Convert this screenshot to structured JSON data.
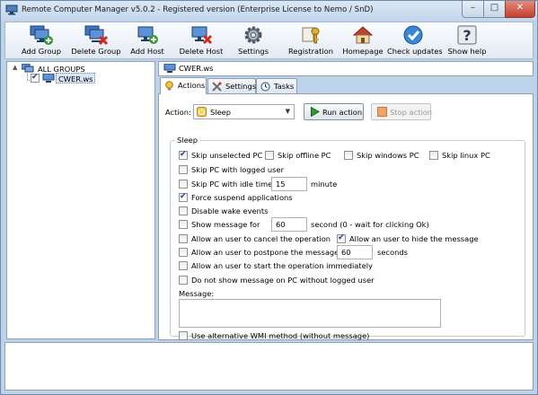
{
  "window": {
    "title": "Remote Computer Manager v5.0.2 - Registered version (Enterprise License to Nemo / SnD)",
    "minimize_glyph": "–",
    "maximize_glyph": "□",
    "close_glyph": "✕"
  },
  "toolbar": {
    "add_group": "Add Group",
    "delete_group": "Delete Group",
    "add_host": "Add Host",
    "delete_host": "Delete Host",
    "settings": "Settings",
    "registration": "Registration",
    "homepage": "Homepage",
    "check_updates": "Check updates",
    "show_help": "Show help"
  },
  "tree": {
    "expander": "▲",
    "root": "ALL GROUPS",
    "host": "CWER.ws"
  },
  "host_bar": {
    "name": "CWER.ws"
  },
  "tabs": {
    "actions": "Actions",
    "settings": "Settings",
    "tasks": "Tasks"
  },
  "actions": {
    "action_label": "Action:",
    "action_value": "Sleep",
    "combo_arrow": "▼",
    "run_button": "Run action",
    "stop_button": "Stop action",
    "group_title": "Sleep",
    "skip_unselected": "Skip unselected PC",
    "skip_offline": "Skip offline PC",
    "skip_windows": "Skip windows PC",
    "skip_linux": "Skip linux PC",
    "skip_logged": "Skip PC with logged user",
    "skip_idle": "Skip PC with idle time <",
    "idle_value": "15",
    "idle_unit": "minute",
    "force_suspend": "Force suspend applications",
    "disable_wake": "Disable wake events",
    "show_message": "Show message for",
    "show_message_value": "60",
    "show_message_unit": "second (0 - wait for clicking Ok)",
    "allow_cancel": "Allow an user to cancel the operation",
    "allow_hide": "Allow an user to hide the message",
    "allow_postpone": "Allow an user to postpone the message for",
    "postpone_value": "60",
    "postpone_unit": "seconds",
    "allow_start": "Allow an user to start the operation immediately",
    "no_show_logged": "Do not show message on PC without logged user",
    "message_label": "Message:",
    "message_value": "",
    "alt_wmi": "Use alternative WMI method (without message)"
  },
  "checkbox_states": {
    "skip_unselected": true,
    "skip_offline": false,
    "skip_windows": false,
    "skip_linux": false,
    "skip_logged": false,
    "skip_idle": false,
    "force_suspend": true,
    "disable_wake": false,
    "show_message": false,
    "allow_cancel": false,
    "allow_hide": true,
    "allow_postpone": false,
    "allow_start": false,
    "no_show_logged": false,
    "alt_wmi": false
  },
  "colors": {
    "window_frame": "#bcd3ea",
    "close_button": "#c3402d",
    "check_mark": "#1a3e9a",
    "run_icon": "#2e9b2e",
    "stop_icon": "#e07b2b"
  }
}
